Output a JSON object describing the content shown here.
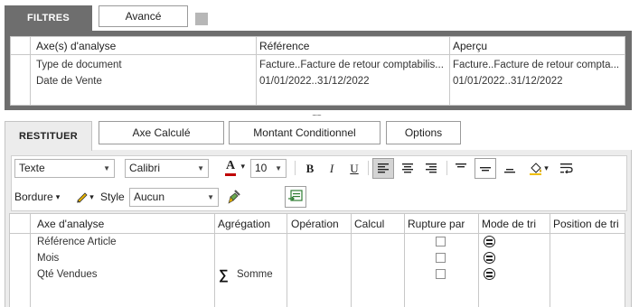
{
  "filtres": {
    "tab_label": "FILTRES",
    "avance_label": "Avancé",
    "columns": [
      "Axe(s) d'analyse",
      "Référence",
      "Aperçu"
    ],
    "rows": [
      {
        "axe": "Type de document",
        "reference": "Facture..Facture de retour comptabilis...",
        "apercu": "Facture..Facture de retour compta..."
      },
      {
        "axe": "Date de Vente",
        "reference": "01/01/2022..31/12/2022",
        "apercu": "01/01/2022..31/12/2022"
      }
    ]
  },
  "splitter": {
    "glyph": "........"
  },
  "restituer": {
    "tab_label": "RESTITUER",
    "buttons": {
      "axe_calcule": "Axe Calculé",
      "montant_conditionnel": "Montant Conditionnel",
      "options": "Options"
    },
    "toolbar": {
      "style_select": "Texte",
      "font_select": "Calibri",
      "font_color_letter": "A",
      "font_size": "10",
      "bold": "B",
      "italic": "I",
      "underline": "U",
      "bordure_label": "Bordure",
      "style_label": "Style",
      "style_value": "Aucun",
      "dropdown_arrow": "▾",
      "select_arrow": "▼"
    },
    "colors": {
      "font_color_bar": "#c00000",
      "panel_bg": "#ececec",
      "tab_dark": "#6e6e6e"
    },
    "columns": [
      "Axe d'analyse",
      "Agrégation",
      "Opération",
      "Calcul",
      "Rupture par",
      "Mode de tri",
      "Position de tri"
    ],
    "rows": [
      {
        "axe": "Référence Article",
        "aggregation_symbol": "",
        "aggregation": ""
      },
      {
        "axe": "Mois",
        "aggregation_symbol": "",
        "aggregation": ""
      },
      {
        "axe": "Qté Vendues",
        "aggregation_symbol": "∑",
        "aggregation": "Somme"
      }
    ]
  }
}
